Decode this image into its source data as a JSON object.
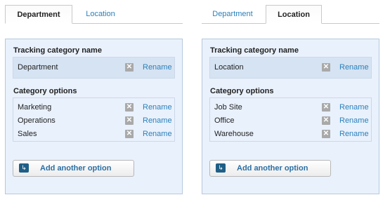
{
  "panels": [
    {
      "tabs": [
        {
          "label": "Department",
          "active": true
        },
        {
          "label": "Location",
          "active": false
        }
      ],
      "tracking_title": "Tracking category name",
      "category_name": "Department",
      "options_title": "Category options",
      "options": [
        "Marketing",
        "Operations",
        "Sales"
      ],
      "rename_label": "Rename",
      "remove_glyph": "✕",
      "add_label": "Add another option",
      "add_icon": "↳"
    },
    {
      "tabs": [
        {
          "label": "Department",
          "active": false
        },
        {
          "label": "Location",
          "active": true
        }
      ],
      "tracking_title": "Tracking category name",
      "category_name": "Location",
      "options_title": "Category options",
      "options": [
        "Job Site",
        "Office",
        "Warehouse"
      ],
      "rename_label": "Rename",
      "remove_glyph": "✕",
      "add_label": "Add another option",
      "add_icon": "↳"
    }
  ],
  "colors": {
    "link": "#2b80b9",
    "panel_bg": "#e9f1fc",
    "name_row_bg": "#d6e3f3",
    "button_icon": "#1f5f86"
  }
}
